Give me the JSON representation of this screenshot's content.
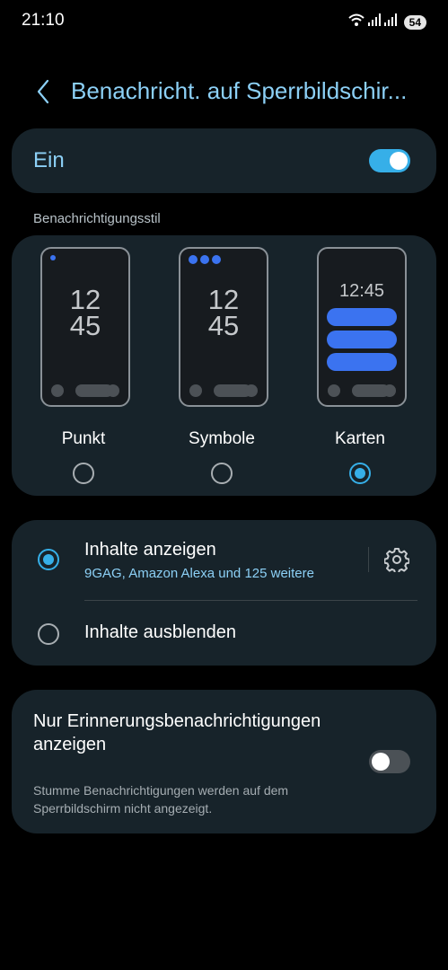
{
  "status_bar": {
    "time": "21:10",
    "battery": "54"
  },
  "header": {
    "title": "Benachricht. auf Sperrbildschir..."
  },
  "master": {
    "label": "Ein",
    "enabled": true
  },
  "style_section": {
    "label": "Benachrichtigungsstil",
    "options": [
      {
        "label": "Punkt",
        "clock": [
          "12",
          "45"
        ],
        "selected": false
      },
      {
        "label": "Symbole",
        "clock": [
          "12",
          "45"
        ],
        "selected": false
      },
      {
        "label": "Karten",
        "clock_inline": "12:45",
        "selected": true
      }
    ]
  },
  "content": {
    "show": {
      "title": "Inhalte anzeigen",
      "subtitle": "9GAG, Amazon Alexa und 125 weitere",
      "selected": true
    },
    "hide": {
      "title": "Inhalte ausblenden",
      "selected": false
    }
  },
  "reminder": {
    "title": "Nur Erinnerungsbenachrichtigungen anzeigen",
    "subtitle": "Stumme Benachrichtigungen werden auf dem Sperrbildschirm nicht angezeigt.",
    "enabled": false
  },
  "colors": {
    "accent": "#36afe8",
    "title_blue": "#8cd0f6",
    "card_bg": "#17232a",
    "notification_blue": "#3b73f0"
  },
  "icons": {
    "back": "chevron-left-icon",
    "settings": "gear-icon",
    "wifi": "wifi-icon",
    "signal": "signal-icon"
  }
}
